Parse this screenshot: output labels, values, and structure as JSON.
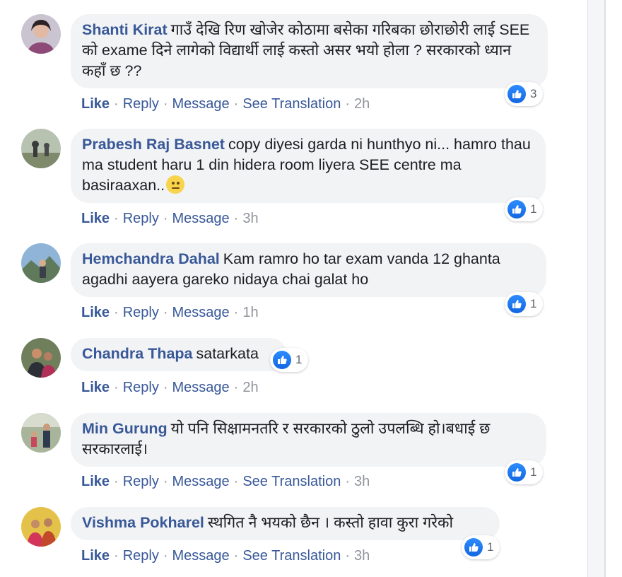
{
  "comments": [
    {
      "author": "Shanti Kirat",
      "text": "गाउँ देखि रिण खोजेर कोठामा बसेका गरिबका छोराछोरी लाई SEE को exame दिने लागेको विद्यार्थी लाई कस्तो असर भयो होला ? सरकारको ध्यान कहाँ छ ??",
      "reactions": "3",
      "actions": {
        "like": "Like",
        "reply": "Reply",
        "message": "Message",
        "translation": "See Translation",
        "time": "2h"
      }
    },
    {
      "author": "Prabesh Raj Basnet",
      "text": "copy diyesi garda ni hunthyo ni... hamro thau ma student haru 1 din hidera room liyera SEE centre ma basiraaxan..",
      "reactions": "1",
      "actions": {
        "like": "Like",
        "reply": "Reply",
        "message": "Message",
        "time": "3h"
      }
    },
    {
      "author": "Hemchandra Dahal",
      "text": "Kam ramro ho tar exam vanda 12 ghanta agadhi aayera gareko nidaya chai galat ho",
      "reactions": "1",
      "actions": {
        "like": "Like",
        "reply": "Reply",
        "message": "Message",
        "time": "1h"
      }
    },
    {
      "author": "Chandra Thapa",
      "text": "satarkata",
      "reactions": "1",
      "actions": {
        "like": "Like",
        "reply": "Reply",
        "message": "Message",
        "time": "2h"
      }
    },
    {
      "author": "Min Gurung",
      "text": "यो पनि सिक्षामनतरि र सरकारको ठुलो उपलब्धि हो।बधाई छ सरकारलाई।",
      "reactions": "1",
      "actions": {
        "like": "Like",
        "reply": "Reply",
        "message": "Message",
        "translation": "See Translation",
        "time": "3h"
      }
    },
    {
      "author": "Vishma Pokharel",
      "text": "स्थगित नै भयको छैन । कस्तो हावा कुरा गरेको",
      "reactions": "1",
      "actions": {
        "like": "Like",
        "reply": "Reply",
        "message": "Message",
        "translation": "See Translation",
        "time": "3h"
      }
    }
  ],
  "icons": {
    "reaction": "like-thumb-icon",
    "emoji": "slightly-smiling-face-icon"
  },
  "colors": {
    "author": "#385898",
    "bubble": "#f2f3f5",
    "meta": "#90949c",
    "like_blue": "#1877f2"
  }
}
